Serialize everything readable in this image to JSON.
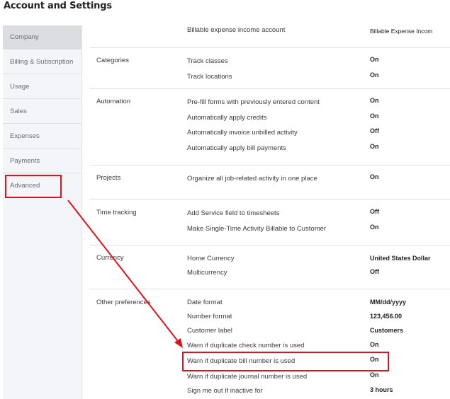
{
  "page": {
    "title": "Account and Settings"
  },
  "sidebar": {
    "items": [
      {
        "label": "Company",
        "active": true
      },
      {
        "label": "Billing & Subscription",
        "active": false
      },
      {
        "label": "Usage",
        "active": false
      },
      {
        "label": "Sales",
        "active": false
      },
      {
        "label": "Expenses",
        "active": false
      },
      {
        "label": "Payments",
        "active": false
      },
      {
        "label": "Advanced",
        "active": false
      }
    ]
  },
  "sections": {
    "billable": {
      "label": "",
      "rows": [
        {
          "label": "Billable expense income account",
          "value": "Billable Expense Incom"
        }
      ]
    },
    "categories": {
      "label": "Categories",
      "rows": [
        {
          "label": "Track classes",
          "value": "On"
        },
        {
          "label": "Track locations",
          "value": "On"
        }
      ]
    },
    "automation": {
      "label": "Automation",
      "rows": [
        {
          "label": "Pre-fill forms with previously entered content",
          "value": "On"
        },
        {
          "label": "Automatically apply credits",
          "value": "On"
        },
        {
          "label": "Automatically invoice unbilled activity",
          "value": "Off"
        },
        {
          "label": "Automatically apply bill payments",
          "value": "On"
        }
      ]
    },
    "projects": {
      "label": "Projects",
      "rows": [
        {
          "label": "Organize all job-related activity in one place",
          "value": "On"
        }
      ]
    },
    "time_tracking": {
      "label": "Time tracking",
      "rows": [
        {
          "label": "Add Service field to timesheets",
          "value": "Off"
        },
        {
          "label": "Make Single-Time Activity Billable to Customer",
          "value": "On"
        }
      ]
    },
    "currency": {
      "label": "Currency",
      "rows": [
        {
          "label": "Home Currency",
          "value": "United States Dollar"
        },
        {
          "label": "Multicurrency",
          "value": "Off"
        }
      ]
    },
    "other": {
      "label": "Other preferences",
      "rows": [
        {
          "label": "Date format",
          "value": "MM/dd/yyyy"
        },
        {
          "label": "Number format",
          "value": "123,456.00"
        },
        {
          "label": "Customer label",
          "value": "Customers"
        },
        {
          "label": "Warn if duplicate check number is used",
          "value": "On"
        },
        {
          "label": "Warn if duplicate bill number is used",
          "value": "On"
        },
        {
          "label": "Warn if duplicate journal number is used",
          "value": "On"
        },
        {
          "label": "Sign me out if inactive for",
          "value": "3 hours"
        }
      ]
    }
  },
  "annotation": {
    "color": "#e0121b"
  }
}
